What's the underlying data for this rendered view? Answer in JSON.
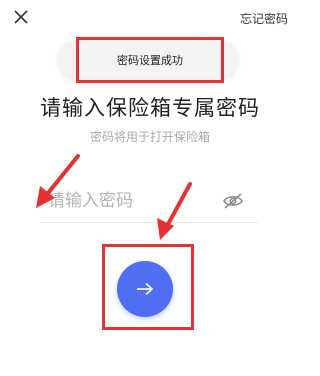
{
  "header": {
    "close_icon": "close-icon",
    "forgot_password": "忘记密码"
  },
  "toast": {
    "message": "密码设置成功"
  },
  "main": {
    "heading": "请输入保险箱专属密码",
    "subtitle": "密码将用于打开保险箱",
    "password_placeholder": "请输入密码",
    "password_value": "",
    "visibility_icon": "eye-hidden-icon",
    "submit_icon": "arrow-right-icon"
  },
  "colors": {
    "accent": "#4f6ef2",
    "highlight": "#e5312f",
    "placeholder": "#b5b5b5",
    "subtitle": "#aaaaaa"
  }
}
